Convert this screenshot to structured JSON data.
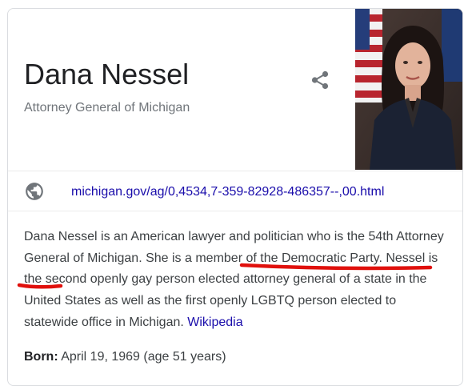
{
  "entity": {
    "name": "Dana Nessel",
    "subtitle": "Attorney General of Michigan"
  },
  "website": {
    "url": "michigan.gov/ag/0,4534,7-359-82928-486357--,00.html"
  },
  "description": {
    "text_before": "Dana Nessel is an American lawyer and politician who is the 54th Attorney General of Michigan. She ",
    "text_highlight": "is a member of the Democratic Party",
    "text_after": ". Nessel is the second openly gay person elected attorney general of a state in the United States as well as the first openly LGBTQ person elected to statewide office in Michigan. ",
    "source_label": "Wikipedia"
  },
  "facts": {
    "born_label": "Born:",
    "born_value": " April 19, 1969 (age 51 years)"
  },
  "colors": {
    "link": "#1a0dab",
    "annotation": "#e0100c",
    "title": "#202124",
    "muted": "#70757a"
  },
  "icons": [
    "share-icon",
    "globe-icon"
  ]
}
